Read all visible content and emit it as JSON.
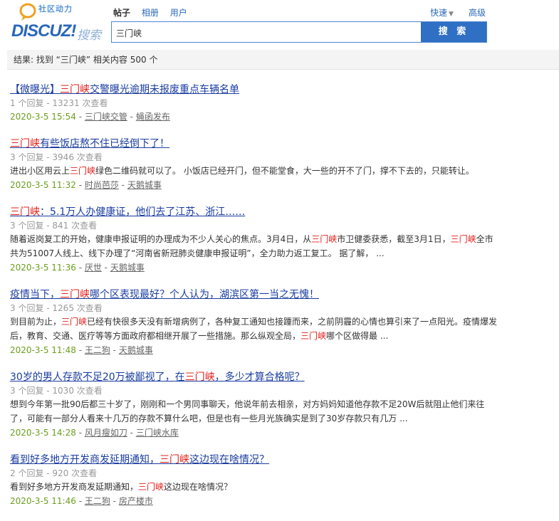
{
  "logo": {
    "cn": "社区动力",
    "main": "DISCUZ!",
    "search": "搜索"
  },
  "tabs": [
    {
      "label": "帖子",
      "active": true
    },
    {
      "label": "相册"
    },
    {
      "label": "用户"
    }
  ],
  "header_links": {
    "quick": "快速",
    "advanced": "高级"
  },
  "search": {
    "value": "三门峡",
    "button": "搜 索"
  },
  "result_bar": "结果: 找到 “三门峡” 相关内容 500 个",
  "results": [
    {
      "title": [
        "【微曝光】",
        "三门峡",
        "交警曝光逾期未报废重点车辆名单"
      ],
      "meta": "1 个回复 - 13231 次查看",
      "snippet": [],
      "date": "2020-3-5 15:54",
      "author": "三门峡交管",
      "forum": "蝇函发布"
    },
    {
      "title": [
        "",
        "三门峡",
        "有些饭店熬不住已经倒下了！"
      ],
      "meta": "3 个回复 - 3946 次查看",
      "snippet": [
        [
          "进出小区用云上",
          "三门峡",
          "绿色二维码就可以了。 小饭店已经开门，但不能堂食，大一些的开不了门，撑不下去的，只能转让。"
        ]
      ],
      "date": "2020-3-5 11:32",
      "author": "时尚芭莎",
      "forum": "天鹅城事"
    },
    {
      "title": [
        "",
        "三门峡",
        "：5.1万人办健康证，他们去了江苏、浙江……"
      ],
      "meta": "3 个回复 - 841 次查看",
      "snippet": [
        [
          "随着返岗复工的开始，健康申报证明的办理成为不少人关心的焦点。3月4日，从",
          "三门峡",
          "市卫健委获悉，截至3月1日，",
          "三门峡",
          "全市"
        ],
        [
          "共为51007人线上、线下办理了“河南省新冠肺炎健康申报证明”，全力助力返工复工。 据了解， ..."
        ]
      ],
      "date": "2020-3-5 11:36",
      "author": "厌世",
      "forum": "天鹅城事"
    },
    {
      "title": [
        "疫情当下，",
        "三门峡",
        "哪个区表现最好？个人认为，湖滨区第一当之无愧！"
      ],
      "meta": "3 个回复 - 1265 次查看",
      "snippet": [
        [
          "到目前为止，",
          "三门峡",
          "已经有快很多天没有新增病例了，各种复工通知也接踵而来，之前阴霾的心情也算引来了一点阳光。疫情爆发"
        ],
        [
          "后，教育、交通、医疗等等方面政府都相继开展了一些措施。那么纵观全局，",
          "三门峡",
          "哪个区做得最 ..."
        ]
      ],
      "date": "2020-3-5 11:48",
      "author": "王二狗",
      "forum": "天鹅城事"
    },
    {
      "title": [
        "30岁的男人存款不足20万被鄙视了，在",
        "三门峡",
        "，多少才算合格呢？"
      ],
      "meta": "3 个回复 - 1030 次查看",
      "snippet": [
        [
          "想到今年第一批90后都三十岁了，刚刚和一个男同事聊天，他说年前去相亲，对方妈妈知道他存款不足20W后就阻止他们来往"
        ],
        [
          "了，可能有一部分人看来十几万的存款不算什么吧，但是也有一些月光族确实是到了30岁存款只有几万 ..."
        ]
      ],
      "date": "2020-3-5 14:28",
      "author": "风月瘦如刀",
      "forum": "三门峡水库"
    },
    {
      "title": [
        "看到好多地方开发商发延期通知，",
        "三门峡",
        "这边现在啥情况？"
      ],
      "meta": "2 个回复 - 920 次查看",
      "snippet": [
        [
          "看到好多地方开发商发延期通知，",
          "三门峡",
          "这边现在啥情况？"
        ]
      ],
      "date": "2020-3-5 11:46",
      "author": "王二狗",
      "forum": "房产楼市"
    }
  ]
}
